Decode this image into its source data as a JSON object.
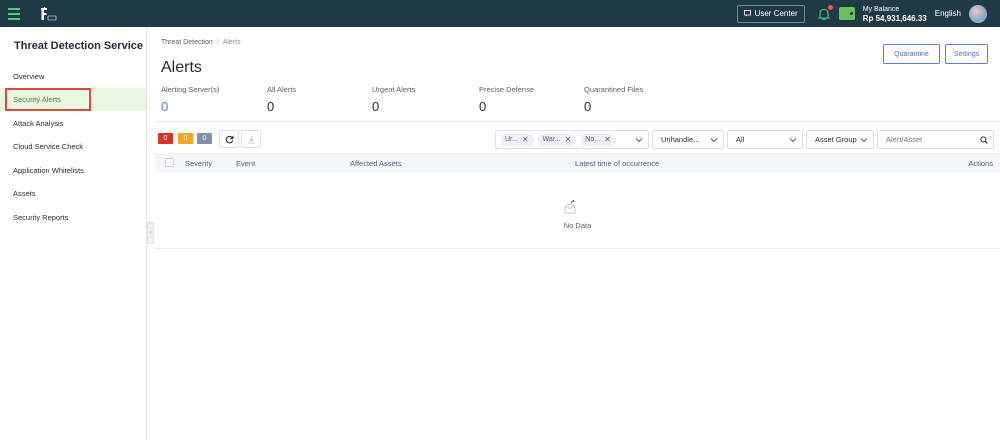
{
  "topbar": {
    "user_center": "User Center",
    "balance_label": "My Balance",
    "balance_value": "Rp 54,931,646.33",
    "language": "English"
  },
  "sidebar": {
    "title": "Threat Detection Service",
    "items": [
      {
        "label": "Overview"
      },
      {
        "label": "Security Alerts"
      },
      {
        "label": "Attack Analysis"
      },
      {
        "label": "Cloud Service Check"
      },
      {
        "label": "Application Whitelists"
      },
      {
        "label": "Assets"
      },
      {
        "label": "Security Reports"
      }
    ]
  },
  "breadcrumb": {
    "parent": "Threat Detection",
    "sep": "/",
    "current": "Alerts"
  },
  "page_title": "Alerts",
  "buttons": {
    "quarantine": "Quarantine",
    "settings": "Settings"
  },
  "stats": [
    {
      "label": "Alerting Server(s)",
      "value": "0"
    },
    {
      "label": "All Alerts",
      "value": "0"
    },
    {
      "label": "Urgent Alerts",
      "value": "0"
    },
    {
      "label": "Precise Defense",
      "value": "0"
    },
    {
      "label": "Quarantined Files",
      "value": "0"
    }
  ],
  "severity_counts": {
    "critical": "0",
    "warning": "0",
    "info": "0"
  },
  "colors": {
    "critical": "#d9322b",
    "warning": "#f5a623",
    "info": "#8190a5",
    "accent": "#5e7ce0",
    "topbar": "#1e3a44"
  },
  "filters": {
    "chips": [
      "Ur...",
      "War...",
      "No..."
    ],
    "status": "Unhandle...",
    "type": "All",
    "asset_group": "Asset Group",
    "search_placeholder": "Alert/Asset"
  },
  "table": {
    "columns": {
      "severity": "Severity",
      "event": "Event",
      "assets": "Affected Assets",
      "time": "Latest time of occurrence",
      "actions": "Actions"
    },
    "empty_text": "No Data"
  }
}
